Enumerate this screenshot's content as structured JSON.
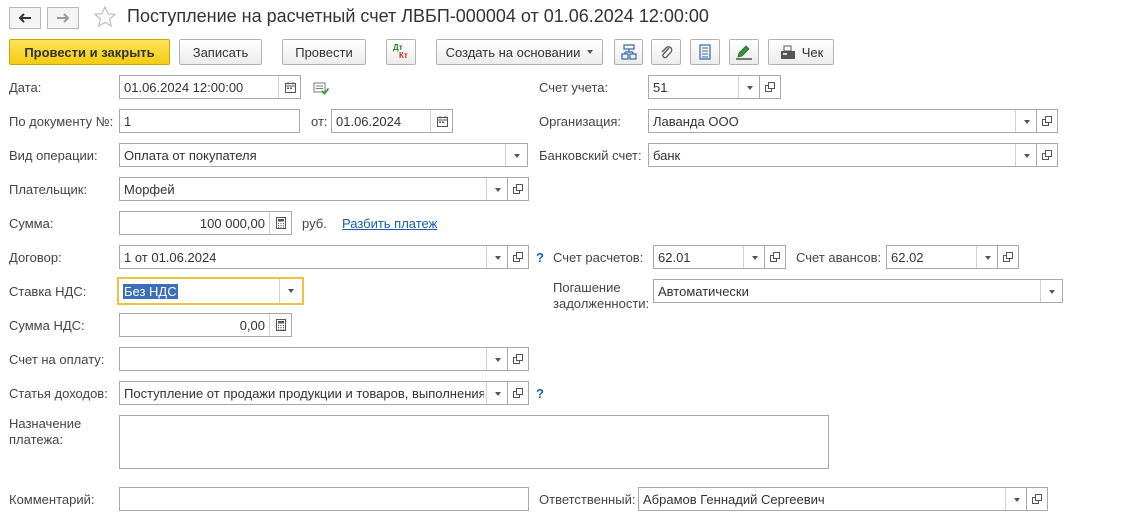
{
  "header": {
    "title": "Поступление на расчетный счет ЛВБП-000004 от 01.06.2024 12:00:00"
  },
  "toolbar": {
    "post_close": "Провести и закрыть",
    "save": "Записать",
    "post": "Провести",
    "create_based": "Создать на основании",
    "check": "Чек",
    "dtkt_top": "Дт",
    "dtkt_bottom": "Кт"
  },
  "form": {
    "date_label": "Дата:",
    "date_value": "01.06.2024 12:00:00",
    "docnum_label": "По документу №:",
    "docnum_value": "1",
    "from_label": "от:",
    "from_value": "01.06.2024",
    "op_label": "Вид операции:",
    "op_value": "Оплата от покупателя",
    "payer_label": "Плательщик:",
    "payer_value": "Морфей",
    "sum_label": "Сумма:",
    "sum_value": "100 000,00",
    "currency": "руб.",
    "split_link": "Разбить платеж",
    "contract_label": "Договор:",
    "contract_value": "1 от 01.06.2024",
    "vat_rate_label": "Ставка НДС:",
    "vat_rate_value": "Без НДС",
    "vat_sum_label": "Сумма НДС:",
    "vat_sum_value": "0,00",
    "invoice_label": "Счет на оплату:",
    "invoice_value": "",
    "income_label": "Статья доходов:",
    "income_value": "Поступление от продажи продукции и товаров, выполнения",
    "purpose_label_1": "Назначение",
    "purpose_label_2": "платежа:",
    "purpose_value": "",
    "comment_label": "Комментарий:",
    "comment_value": "",
    "account_label": "Счет учета:",
    "account_value": "51",
    "org_label": "Организация:",
    "org_value": "Лаванда ООО",
    "bank_label": "Банковский счет:",
    "bank_value": "банк",
    "settle_label": "Счет расчетов:",
    "settle_value": "62.01",
    "advance_label": "Счет авансов:",
    "advance_value": "62.02",
    "debt_label_1": "Погашение",
    "debt_label_2": "задолженности:",
    "debt_value": "Автоматически",
    "resp_label": "Ответственный:",
    "resp_value": "Абрамов Геннадий Сергеевич",
    "help_mark": "?"
  },
  "colors": {
    "primary_button": "#f3cc11",
    "link": "#1a5ea8",
    "focus": "#f0c33c",
    "selection": "#3d6fb8"
  }
}
